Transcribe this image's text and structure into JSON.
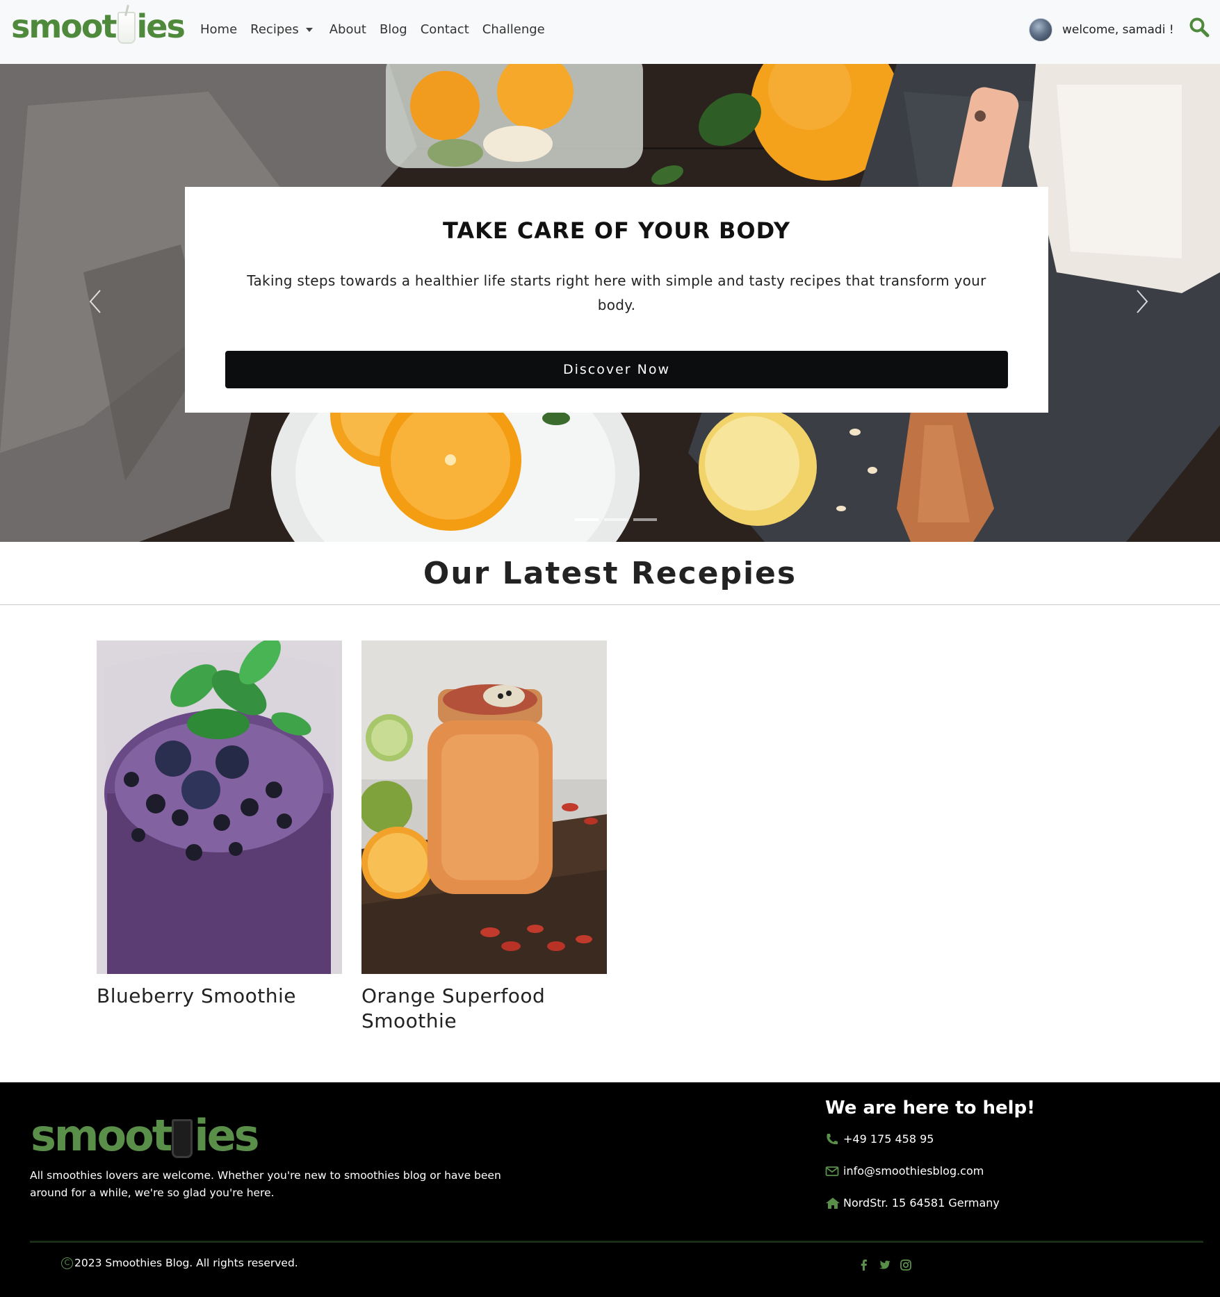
{
  "nav": {
    "logo_text_left": "smoot",
    "logo_text_right": "ies",
    "links": [
      {
        "label": "Home"
      },
      {
        "label": "Recipes",
        "has_dropdown": true
      },
      {
        "label": "About"
      },
      {
        "label": "Blog"
      },
      {
        "label": "Contact"
      },
      {
        "label": "Challenge"
      }
    ],
    "welcome_text": "welcome, samadi !",
    "accent_color": "#4f8a3c"
  },
  "hero": {
    "title": "TAKE CARE OF YOUR BODY",
    "text": "Taking steps towards a healthier life starts right here with simple and tasty recipes that transform your body.",
    "button_label": "Discover Now",
    "slides_count": 3,
    "active_slide": 1
  },
  "latest": {
    "title": "Our Latest Recepies",
    "recipes": [
      {
        "title": "Blueberry Smoothie"
      },
      {
        "title": "Orange Superfood Smoothie"
      }
    ]
  },
  "footer": {
    "logo_text_left": "smoot",
    "logo_text_right": "ies",
    "about": "All smoothies lovers are welcome. Whether you're new to smoothies blog or have been around for a while, we're so glad you're here.",
    "help_title": "We are here to help!",
    "phone": "+49 175 458 95",
    "email": "info@smoothiesblog.com",
    "address": "NordStr. 15 64581 Germany",
    "copyright": "2023 Smoothies Blog. All rights reserved.",
    "accent_color": "#5a8f4a"
  }
}
